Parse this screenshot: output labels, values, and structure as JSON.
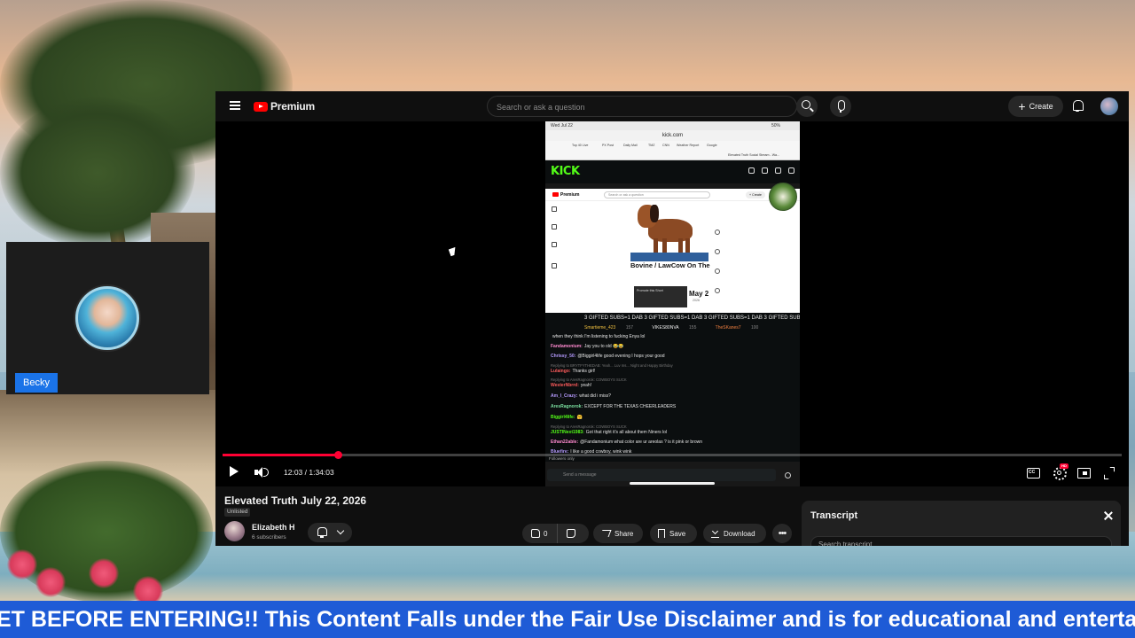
{
  "background": {
    "description_colors": {
      "sky": "#e8b993",
      "sea": "#7eaebf",
      "sand": "#e9dcc4"
    }
  },
  "youtube": {
    "logo_text": "Premium",
    "search_placeholder": "Search or ask a question",
    "create_label": "Create",
    "icons": [
      "menu-icon",
      "search-icon",
      "mic-icon",
      "plus-icon",
      "bell-icon",
      "avatar"
    ]
  },
  "player": {
    "time_current": "12:03",
    "time_total": "1:34:03",
    "time_display": "12:03 / 1:34:03",
    "progress_fraction": 0.128,
    "hd_badge": "HD"
  },
  "embedded": {
    "status_time": "Wed Jul 22",
    "status_battery": "50%",
    "url": "kick.com",
    "bookmarks": [
      "Top 40 Live",
      "PX Post",
      "Daily Mail",
      "TMZ",
      "CNN",
      "Weather Report",
      "Google",
      "Elevated Truth Social Stream - Wa..."
    ],
    "kick_logo": "KICK",
    "inner_logo": "Premium",
    "inner_search": "Search or ask a question",
    "inner_create": "+ Create",
    "inner_title": "Bovine / LawCow On The",
    "inner_short_label": "Promote this Short",
    "inner_date": "May 2",
    "inner_date_sub": "2026",
    "gift_ticker": "3 GIFTED SUBS=1 DAB 3 GIFTED SUBS=1 DAB 3 GIFTED SUBS=1 DAB 3 GIFTED SUBS=1",
    "pinned": [
      {
        "name": "Smartieme_423",
        "count": "157"
      },
      {
        "name": "VIKES80NVA",
        "count": "155"
      },
      {
        "name": "TheSKanes7",
        "count": "100"
      }
    ],
    "chat": [
      {
        "user": "",
        "text": "when they think I'm listening to fucking Enya lol",
        "color": "#e6e6e6"
      },
      {
        "user": "Fandamonium:",
        "text": "Jay you to old 😂😂",
        "color": "#ff8ad0"
      },
      {
        "user": "Chrissy_50:",
        "text": "@Biggirl4life good evening I hops your good",
        "color": "#b69bff"
      },
      {
        "user": "",
        "text": "Replying to BRYTFYTHEDAB: Yeah... Luv ms... Night and Happy Birthday",
        "color": "#777777",
        "reply": true
      },
      {
        "user": "Lulaingo:",
        "text": "Thanks girl!",
        "color": "#ff5c5c"
      },
      {
        "user": "",
        "text": "Replying to AresRagnorok: COWBOYS SUCK",
        "color": "#777777",
        "reply": true
      },
      {
        "user": "WesterNbrrd:",
        "text": "yeah!",
        "color": "#ff5c5c"
      },
      {
        "user": "Am_I_Crazy:",
        "text": "what did i miss?",
        "color": "#b69bff"
      },
      {
        "user": "AresRagnorok:",
        "text": "EXCEPT FOR THE TEXAS CHEERLEADERS",
        "color": "#7be0a0"
      },
      {
        "user": "Biggirl4life:",
        "text": "🤗",
        "color": "#53fc18"
      },
      {
        "user": "",
        "text": "Replying to AresRagnorok: COWBOYS SUCK",
        "color": "#777777",
        "reply": true
      },
      {
        "user": "JUSTINext1983:",
        "text": "Got that right it's all about them Niners lol",
        "color": "#53fc18"
      },
      {
        "user": "Ethan22able:",
        "text": "@Fandamonium what color are ur areolas ? is it pink or brown",
        "color": "#ff8ad0"
      },
      {
        "user": "Bluefire:",
        "text": "I like a good cowboy, wink wink",
        "color": "#b69bff"
      }
    ],
    "followers_only": "Followers only",
    "chat_placeholder": "Send a message"
  },
  "video": {
    "title": "Elevated Truth July 22, 2026",
    "visibility": "Unlisted",
    "channel_name": "Elizabeth H",
    "subscribers": "6 subscribers",
    "likes": "0",
    "share_label": "Share",
    "save_label": "Save",
    "download_label": "Download",
    "more_label": "•••"
  },
  "transcript": {
    "title": "Transcript",
    "search_placeholder": "Search transcript"
  },
  "webcam": {
    "name": "Becky"
  },
  "ticker": {
    "text": "ET BEFORE ENTERING!! This Content Falls under the Fair Use Disclaimer and is for educational and entertai",
    "background": "#1e5bd6"
  }
}
